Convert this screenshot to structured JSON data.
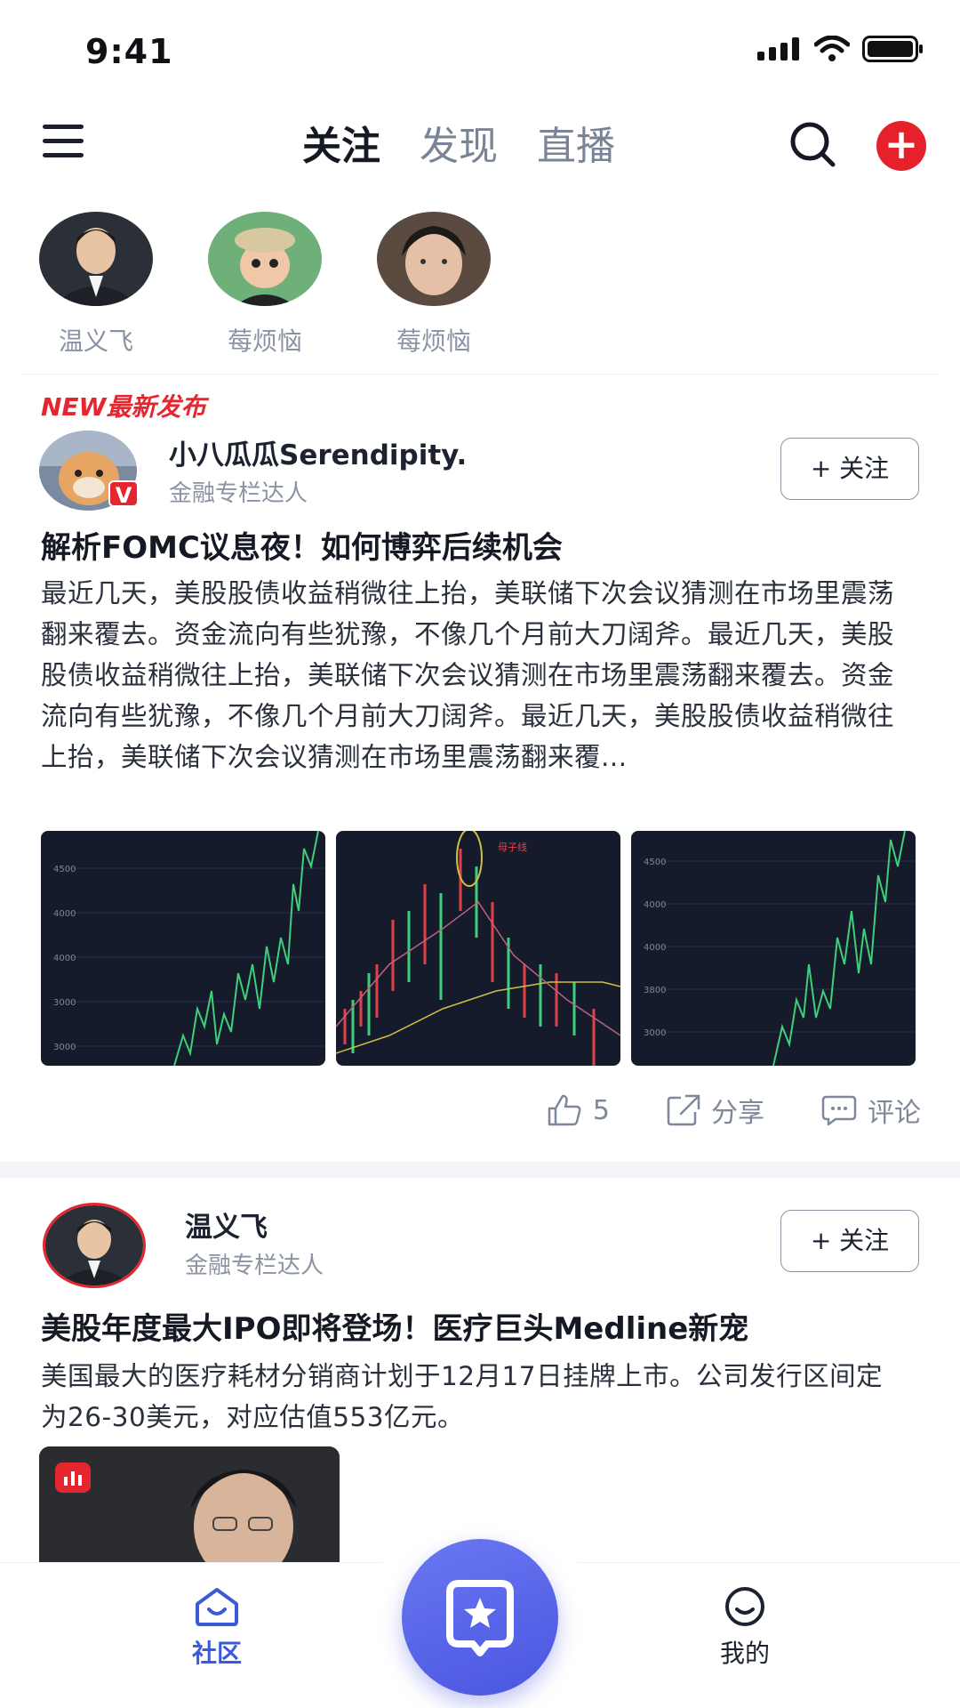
{
  "status_bar": {
    "time": "9:41"
  },
  "nav": {
    "tabs": [
      {
        "label": "关注",
        "active": true
      },
      {
        "label": "发现",
        "active": false
      },
      {
        "label": "直播",
        "active": false
      }
    ]
  },
  "following": [
    {
      "name": "温义飞"
    },
    {
      "name": "莓烦恼"
    },
    {
      "name": "莓烦恼"
    }
  ],
  "new_tag": "NEW最新发布",
  "posts": [
    {
      "author": "小八瓜瓜Serendipity.",
      "role": "金融专栏达人",
      "verified_badge": "V",
      "follow_label": "+ 关注",
      "title": "解析FOMC议息夜！如何博弈后续机会",
      "body": "最近几天，美股股债收益稍微往上抬，美联储下次会议猜测在市场里震荡翻来覆去。资金流向有些犹豫，不像几个月前大刀阔斧。最近几天，美股股债收益稍微往上抬，美联储下次会议猜测在市场里震荡翻来覆去。资金流向有些犹豫，不像几个月前大刀阔斧。最近几天，美股股债收益稍微往上抬，美联储下次会议猜测在市场里震荡翻来覆...",
      "images": [
        {
          "ticks": [
            "4500",
            "4000",
            "4000",
            "3000",
            "3000"
          ]
        },
        {
          "annotation": "母子线"
        },
        {
          "ticks": [
            "4500",
            "4000",
            "4000",
            "3800",
            "3000"
          ]
        }
      ],
      "likes": "5",
      "share_label": "分享",
      "comment_label": "评论"
    },
    {
      "author": "温义飞",
      "role": "金融专栏达人",
      "follow_label": "+ 关注",
      "title": "美股年度最大IPO即将登场！医疗巨头Medline新宠",
      "body": "美国最大的医疗耗材分销商计划于12月17日挂牌上市。公司发行区间定为26-30美元，对应估值553亿元。"
    }
  ],
  "tabbar": {
    "community_label": "社区",
    "mine_label": "我的"
  },
  "colors": {
    "accent": "#3a5bd9",
    "red": "#e5262f",
    "chart_bg": "#151b2b",
    "chart_line": "#3ecf7a"
  }
}
